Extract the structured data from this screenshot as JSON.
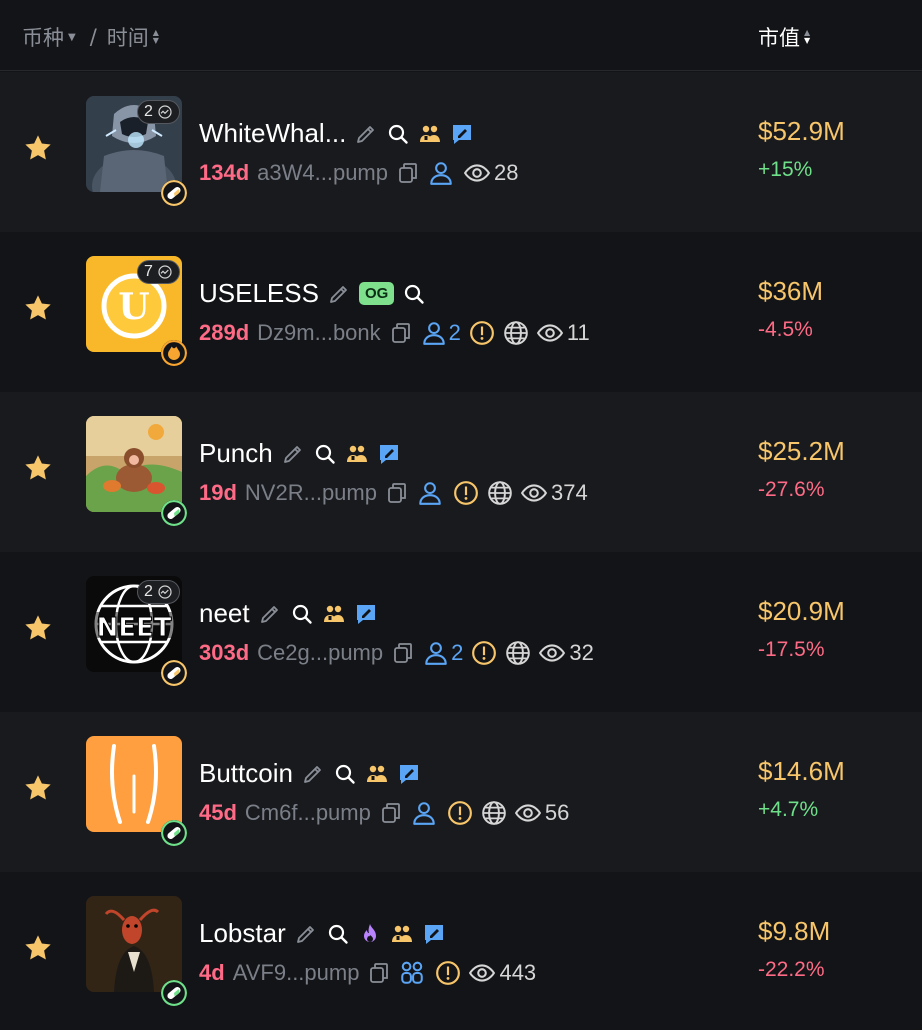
{
  "header": {
    "coin_label": "币种",
    "separator": "/",
    "time_label": "时间",
    "mcap_label": "市值"
  },
  "colors": {
    "background": "#131417",
    "row_alt": "#191a1e",
    "mcap": "#f7c56a",
    "positive": "#6fe08a",
    "negative": "#ff6b86",
    "age": "#ff6b86",
    "star": "#f7c56a",
    "holders_blue": "#5aa5f5"
  },
  "rows": [
    {
      "name": "WhiteWhal...",
      "age": "134d",
      "address": "a3W4...pump",
      "holders": "",
      "views": "28",
      "market_cap": "$52.9M",
      "change": "+15%",
      "badge_count": "2",
      "platform": "pill-yellow",
      "extra_icons": [
        "edit-icon",
        "search-icon",
        "group-icon",
        "chat-icon"
      ]
    },
    {
      "name": "USELESS",
      "og": "OG",
      "age": "289d",
      "address": "Dz9m...bonk",
      "holders": "2",
      "views": "11",
      "market_cap": "$36M",
      "change": "-4.5%",
      "badge_count": "7",
      "platform": "bonk",
      "extra_icons": [
        "edit-icon",
        "search-icon"
      ]
    },
    {
      "name": "Punch",
      "age": "19d",
      "address": "NV2R...pump",
      "holders": "",
      "views": "374",
      "market_cap": "$25.2M",
      "change": "-27.6%",
      "platform": "pill-green",
      "extra_icons": [
        "edit-icon",
        "search-icon",
        "group-icon",
        "chat-icon"
      ]
    },
    {
      "name": "neet",
      "age": "303d",
      "address": "Ce2g...pump",
      "holders": "2",
      "views": "32",
      "market_cap": "$20.9M",
      "change": "-17.5%",
      "badge_count": "2",
      "platform": "pill-yellow",
      "extra_icons": [
        "edit-icon",
        "search-icon",
        "group-icon",
        "chat-icon"
      ]
    },
    {
      "name": "Buttcoin",
      "age": "45d",
      "address": "Cm6f...pump",
      "holders": "",
      "views": "56",
      "market_cap": "$14.6M",
      "change": "+4.7%",
      "platform": "pill-green",
      "extra_icons": [
        "edit-icon",
        "search-icon",
        "group-icon",
        "chat-icon"
      ]
    },
    {
      "name": "Lobstar",
      "age": "4d",
      "address": "AVF9...pump",
      "holders": "",
      "views": "443",
      "market_cap": "$9.8M",
      "change": "-22.2%",
      "platform": "pill-green",
      "extra_icons": [
        "edit-icon",
        "search-icon",
        "fire-icon",
        "group-icon",
        "chat-icon"
      ]
    }
  ]
}
